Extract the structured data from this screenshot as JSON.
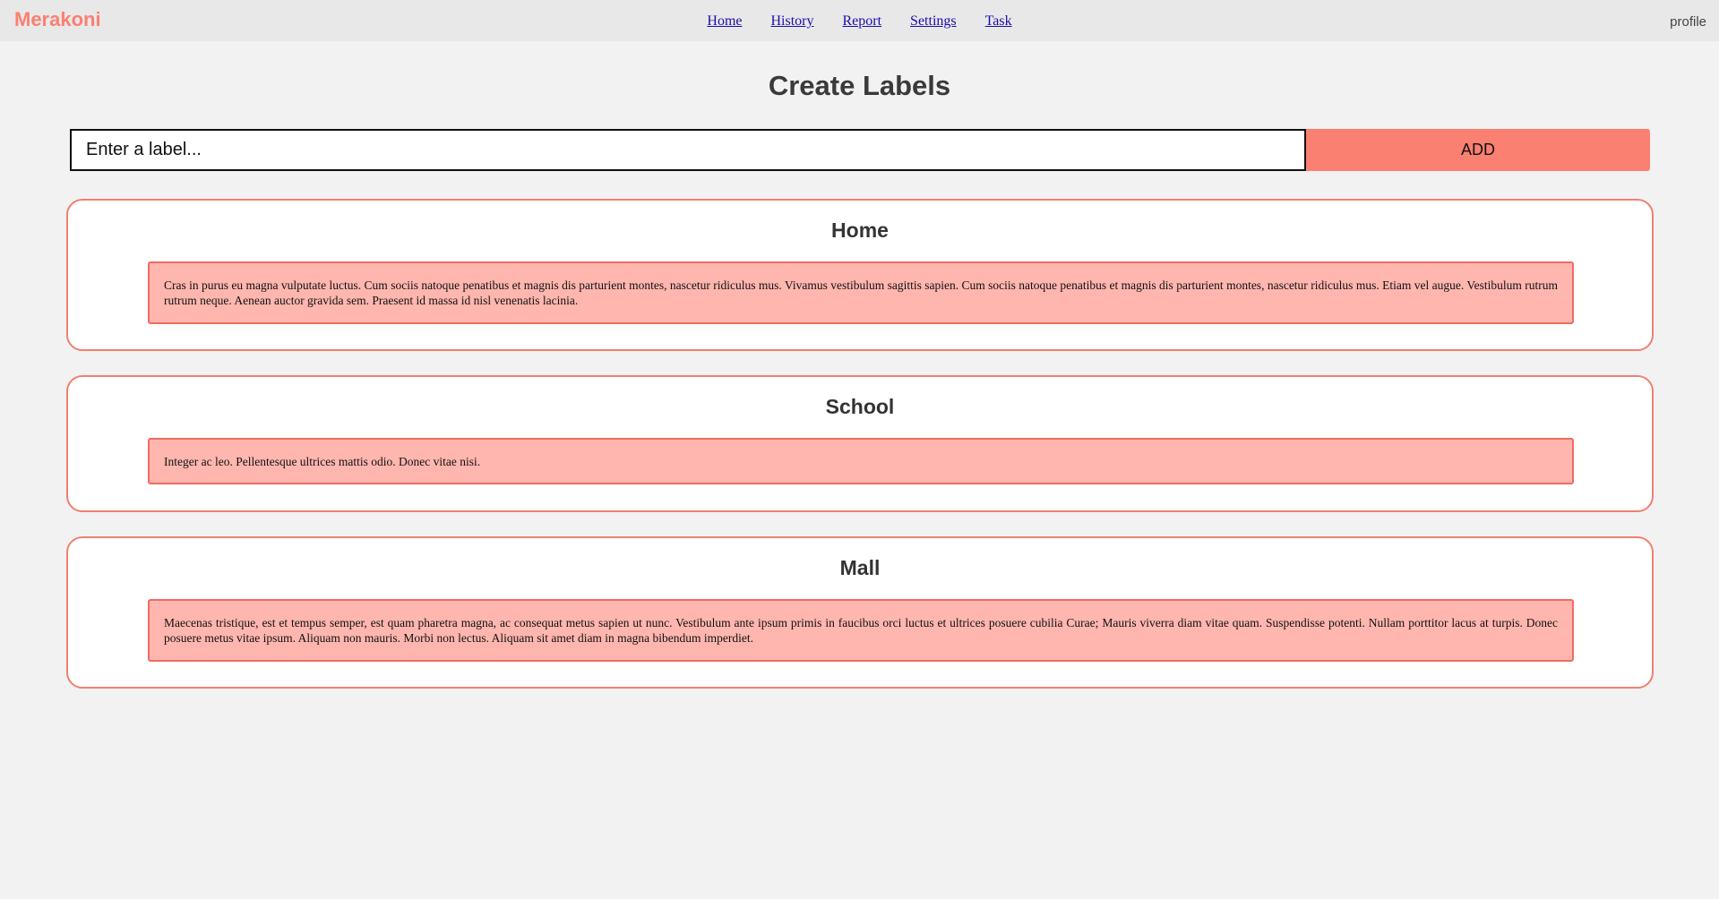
{
  "brand": "Merakoni",
  "nav": {
    "items": [
      "Home",
      "History",
      "Report",
      "Settings",
      "Task"
    ]
  },
  "profile_label": "profile",
  "page_title": "Create Labels",
  "label_form": {
    "placeholder": "Enter a label...",
    "value": "",
    "add_label": "ADD"
  },
  "labels": [
    {
      "title": "Home",
      "description": "Cras in purus eu magna vulputate luctus. Cum sociis natoque penatibus et magnis dis parturient montes, nascetur ridiculus mus. Vivamus vestibulum sagittis sapien. Cum sociis natoque penatibus et magnis dis parturient montes, nascetur ridiculus mus. Etiam vel augue. Vestibulum rutrum rutrum neque. Aenean auctor gravida sem. Praesent id massa id nisl venenatis lacinia."
    },
    {
      "title": "School",
      "description": "Integer ac leo. Pellentesque ultrices mattis odio. Donec vitae nisi."
    },
    {
      "title": "Mall",
      "description": "Maecenas tristique, est et tempus semper, est quam pharetra magna, ac consequat metus sapien ut nunc. Vestibulum ante ipsum primis in faucibus orci luctus et ultrices posuere cubilia Curae; Mauris viverra diam vitae quam. Suspendisse potenti. Nullam porttitor lacus at turpis. Donec posuere metus vitae ipsum. Aliquam non mauris. Morbi non lectus. Aliquam sit amet diam in magna bibendum imperdiet."
    }
  ],
  "colors": {
    "brand": "#fa8072",
    "accent": "#fa8072",
    "card_border": "#f08070",
    "description_background": "#ffb6ae",
    "nav_link": "#1a0dab"
  }
}
